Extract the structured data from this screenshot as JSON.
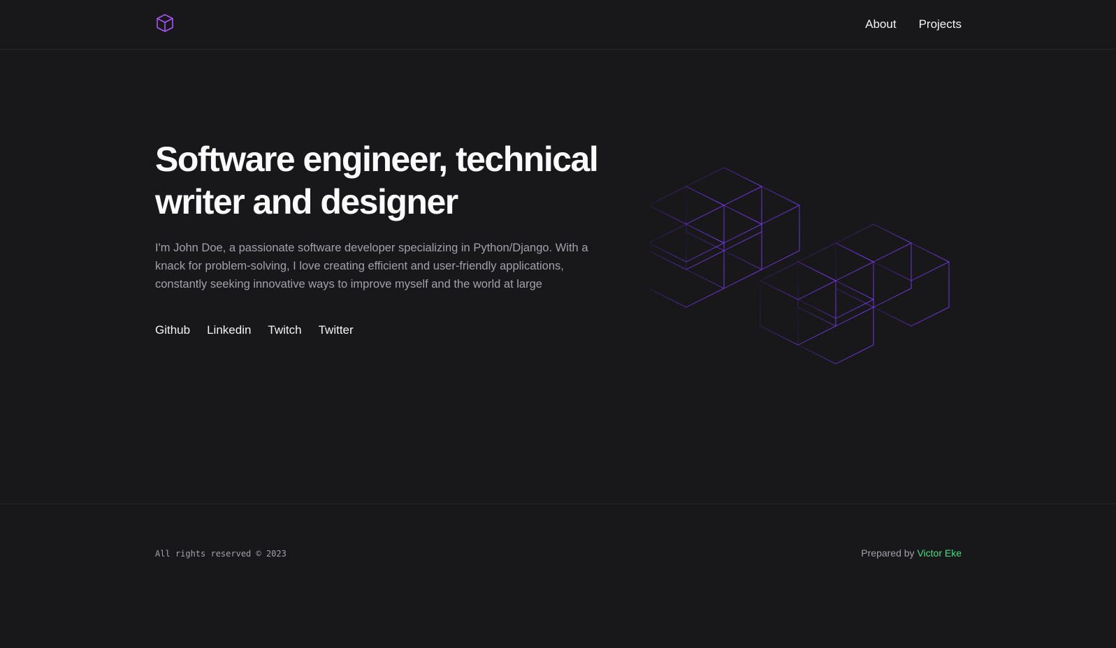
{
  "header": {
    "logo_icon": "cube-icon",
    "nav": [
      {
        "label": "About"
      },
      {
        "label": "Projects"
      }
    ]
  },
  "hero": {
    "title": "Software engineer, technical writer and designer",
    "description": "I'm John Doe, a passionate software developer specializing in Python/Django. With a knack for problem-solving, I love creating efficient and user-friendly applications, constantly seeking innovative ways to improve myself and the world at large",
    "social": [
      {
        "label": "Github"
      },
      {
        "label": "Linkedin"
      },
      {
        "label": "Twitch"
      },
      {
        "label": "Twitter"
      }
    ],
    "illustration_icon": "isometric-cubes-icon"
  },
  "footer": {
    "copyright": "All rights reserved © 2023",
    "prepared_prefix": "Prepared by ",
    "prepared_name": "Victor Eke"
  },
  "colors": {
    "background": "#18181b",
    "accent": "#a855f7",
    "cube_stroke": "#6d28d9",
    "link_green": "#4ade80"
  }
}
